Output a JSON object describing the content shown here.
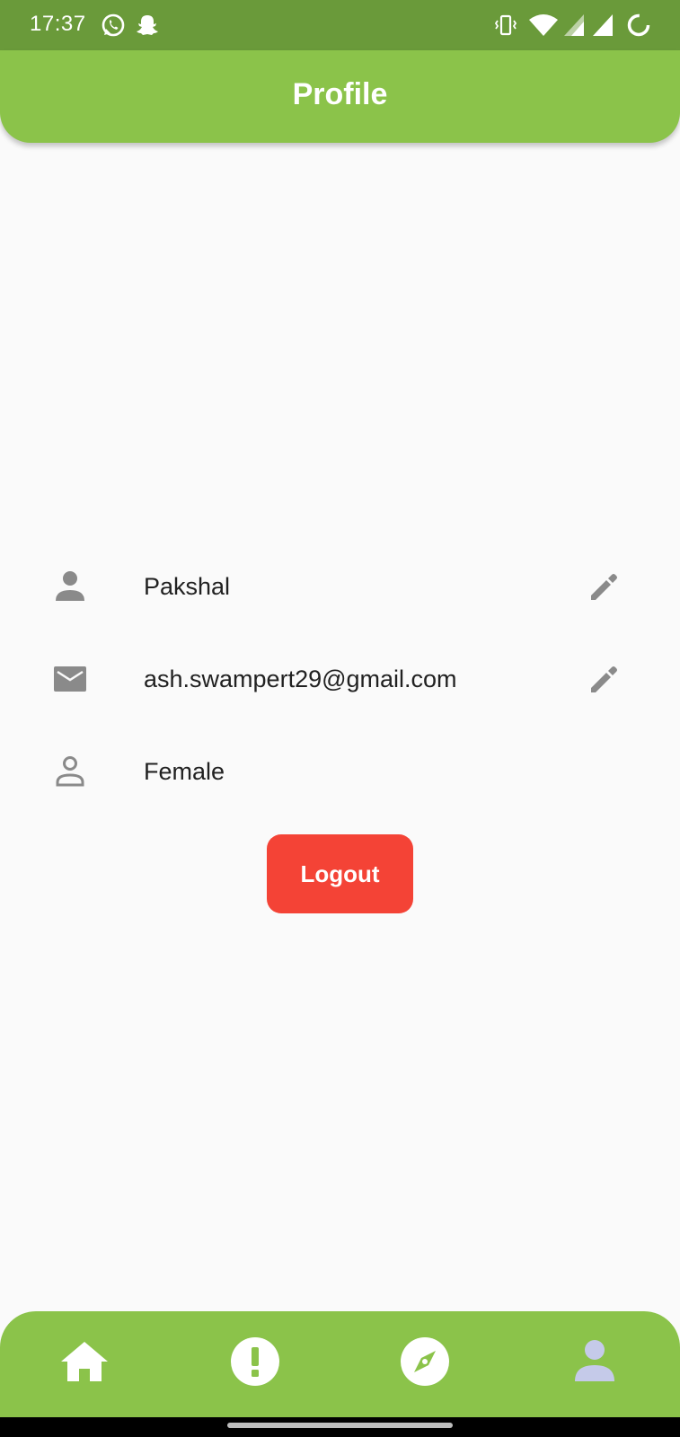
{
  "status_bar": {
    "time": "17:37",
    "left_icons": [
      "whatsapp-icon",
      "snapchat-icon"
    ],
    "right_icons": [
      "vibrate-icon",
      "wifi-icon",
      "signal-icon",
      "signal-icon",
      "battery-charging-icon"
    ]
  },
  "app_bar": {
    "title": "Profile"
  },
  "profile": {
    "name": {
      "value": "Pakshal",
      "icon": "person-icon",
      "editable": true
    },
    "email": {
      "value": "ash.swampert29@gmail.com",
      "icon": "email-icon",
      "editable": true
    },
    "gender": {
      "value": "Female",
      "icon": "person-outline-icon",
      "editable": false
    }
  },
  "logout_button": {
    "label": "Logout"
  },
  "bottom_nav": {
    "items": [
      {
        "icon": "home-icon",
        "selected": false
      },
      {
        "icon": "alert-icon",
        "selected": false
      },
      {
        "icon": "explore-icon",
        "selected": false
      },
      {
        "icon": "person-icon",
        "selected": true
      }
    ]
  },
  "colors": {
    "status_bar": "#6a9a3a",
    "primary": "#8bc34a",
    "logout": "#f44336",
    "icon_grey": "#8a8a8a",
    "nav_icon": "#ffffff",
    "nav_selected_icon": "#c5cae9"
  }
}
